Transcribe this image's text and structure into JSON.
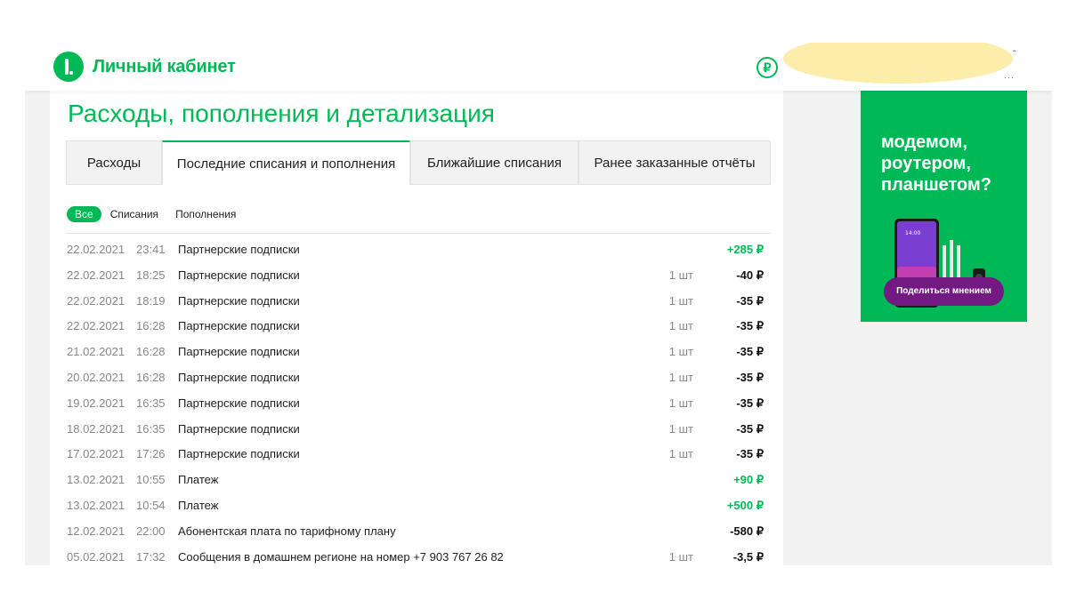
{
  "header": {
    "brand": "Личный кабинет",
    "ruble_symbol": "₽"
  },
  "page": {
    "title": "Расходы, пополнения и детализация"
  },
  "tabs": [
    {
      "label": "Расходы",
      "active": false
    },
    {
      "label": "Последние списания и пополнения",
      "active": true
    },
    {
      "label": "Ближайшие списания",
      "active": false
    },
    {
      "label": "Ранее заказанные отчёты",
      "active": false
    }
  ],
  "filters": [
    {
      "label": "Все",
      "active": true
    },
    {
      "label": "Списания",
      "active": false
    },
    {
      "label": "Пополнения",
      "active": false
    }
  ],
  "transactions": [
    {
      "date": "22.02.2021",
      "time": "23:41",
      "description": "Партнерские подписки",
      "qty": "",
      "amount": "+285 ₽",
      "positive": true
    },
    {
      "date": "22.02.2021",
      "time": "18:25",
      "description": "Партнерские подписки",
      "qty": "1 шт",
      "amount": "-40 ₽",
      "positive": false
    },
    {
      "date": "22.02.2021",
      "time": "18:19",
      "description": "Партнерские подписки",
      "qty": "1 шт",
      "amount": "-35 ₽",
      "positive": false
    },
    {
      "date": "22.02.2021",
      "time": "16:28",
      "description": "Партнерские подписки",
      "qty": "1 шт",
      "amount": "-35 ₽",
      "positive": false
    },
    {
      "date": "21.02.2021",
      "time": "16:28",
      "description": "Партнерские подписки",
      "qty": "1 шт",
      "amount": "-35 ₽",
      "positive": false
    },
    {
      "date": "20.02.2021",
      "time": "16:28",
      "description": "Партнерские подписки",
      "qty": "1 шт",
      "amount": "-35 ₽",
      "positive": false
    },
    {
      "date": "19.02.2021",
      "time": "16:35",
      "description": "Партнерские подписки",
      "qty": "1 шт",
      "amount": "-35 ₽",
      "positive": false
    },
    {
      "date": "18.02.2021",
      "time": "16:35",
      "description": "Партнерские подписки",
      "qty": "1 шт",
      "amount": "-35 ₽",
      "positive": false
    },
    {
      "date": "17.02.2021",
      "time": "17:26",
      "description": "Партнерские подписки",
      "qty": "1 шт",
      "amount": "-35 ₽",
      "positive": false
    },
    {
      "date": "13.02.2021",
      "time": "10:55",
      "description": "Платеж",
      "qty": "",
      "amount": "+90 ₽",
      "positive": true
    },
    {
      "date": "13.02.2021",
      "time": "10:54",
      "description": "Платеж",
      "qty": "",
      "amount": "+500 ₽",
      "positive": true
    },
    {
      "date": "12.02.2021",
      "time": "22:00",
      "description": "Абонентская плата по тарифному плану",
      "qty": "",
      "amount": "-580 ₽",
      "positive": false
    },
    {
      "date": "05.02.2021",
      "time": "17:32",
      "description": "Сообщения в домашнем регионе на номер +7 903 767 26 82",
      "qty": "1 шт",
      "amount": "-3,5 ₽",
      "positive": false
    }
  ],
  "ad": {
    "lines": [
      "модемом,",
      "роутером,",
      "планшетом?"
    ],
    "button": "Поделиться мнением",
    "device_time": "14:00"
  },
  "colors": {
    "brand_green": "#00b956",
    "ad_button_purple": "#731982",
    "redaction": "#fdedab"
  }
}
